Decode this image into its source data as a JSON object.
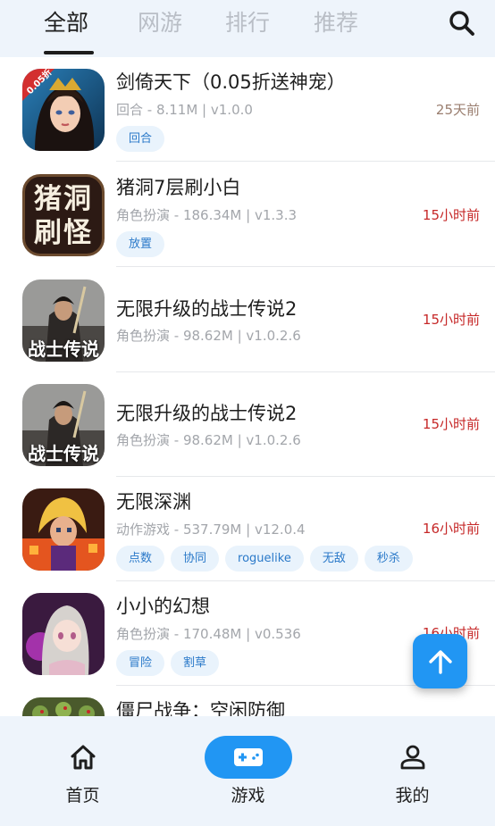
{
  "top_tabs": [
    {
      "label": "全部",
      "active": true
    },
    {
      "label": "网游",
      "active": false
    },
    {
      "label": "排行",
      "active": false
    },
    {
      "label": "推荐",
      "active": false
    }
  ],
  "search_icon": "search-icon",
  "games": [
    {
      "title": "剑倚天下（0.05折送神宠）",
      "meta": "回合 - 8.11M | v1.0.0",
      "time": "25天前",
      "tags": [
        "回合"
      ],
      "icon_badge": "0.05折",
      "icon_text": ""
    },
    {
      "title": "猪洞7层刷小白",
      "meta": "角色扮演 - 186.34M | v1.3.3",
      "time": "15小时前",
      "tags": [
        "放置"
      ],
      "icon_badge": "",
      "icon_text": "猪洞刷怪"
    },
    {
      "title": "无限升级的战士传说2",
      "meta": "角色扮演 - 98.62M | v1.0.2.6",
      "time": "15小时前",
      "tags": [],
      "icon_badge": "",
      "icon_text": "战士传说"
    },
    {
      "title": "无限升级的战士传说2",
      "meta": "角色扮演 - 98.62M | v1.0.2.6",
      "time": "15小时前",
      "tags": [],
      "icon_badge": "",
      "icon_text": "战士传说"
    },
    {
      "title": "无限深渊",
      "meta": "动作游戏 - 537.79M | v12.0.4",
      "time": "16小时前",
      "tags": [
        "点数",
        "协同",
        "roguelike",
        "无敌",
        "秒杀"
      ],
      "icon_badge": "",
      "icon_text": ""
    },
    {
      "title": "小小的幻想",
      "meta": "角色扮演 - 170.48M | v0.536",
      "time": "16小时前",
      "tags": [
        "冒险",
        "割草"
      ],
      "icon_badge": "",
      "icon_text": ""
    },
    {
      "title": "僵尸战争：空闲防御",
      "meta": "",
      "time": "",
      "tags": [],
      "icon_badge": "",
      "icon_text": ""
    }
  ],
  "fab_icon": "arrow-up-icon",
  "bottom_nav": [
    {
      "label": "首页",
      "icon": "home-icon",
      "active": false
    },
    {
      "label": "游戏",
      "icon": "gamepad-icon",
      "active": true
    },
    {
      "label": "我的",
      "icon": "person-icon",
      "active": false
    }
  ],
  "colors": {
    "accent": "#2196f3",
    "time_recent": "#c62828",
    "time_old": "#9a7e6f",
    "tag_bg": "#e9f3fc",
    "tag_text": "#2a79c9"
  }
}
